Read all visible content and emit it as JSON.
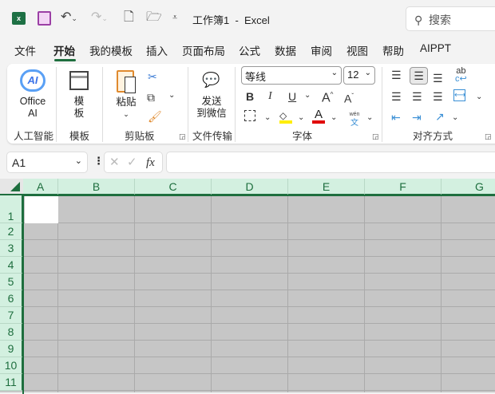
{
  "titlebar": {
    "app_icon": "excel-icon",
    "title": "工作簿1  -  Excel",
    "search_placeholder": "搜索"
  },
  "menu": {
    "tabs": [
      "文件",
      "开始",
      "我的模板",
      "插入",
      "页面布局",
      "公式",
      "数据",
      "审阅",
      "视图",
      "帮助",
      "AIPPT"
    ],
    "active": "开始"
  },
  "ribbon": {
    "office_ai": {
      "line1": "Office",
      "line2": "AI",
      "icon_text": "AI",
      "group": "人工智能"
    },
    "template": {
      "line1": "模",
      "line2": "板",
      "group": "模板"
    },
    "clipboard": {
      "paste": "粘贴",
      "group": "剪贴板"
    },
    "wechat": {
      "line1": "发送",
      "line2": "到微信",
      "group": "文件传输"
    },
    "font": {
      "name": "等线",
      "size": "12",
      "bold": "B",
      "italic": "I",
      "underline": "U",
      "grow": "A",
      "shrink": "A",
      "font_color": "A",
      "phonetic_top": "wén",
      "phonetic_bottom": "文",
      "group": "字体",
      "fill_color": "#ffee00",
      "text_color": "#e00000"
    },
    "alignment": {
      "wrap": "ab",
      "group": "对齐方式"
    }
  },
  "formula_bar": {
    "name_box": "A1",
    "fx": "fx",
    "formula": ""
  },
  "sheet": {
    "columns": [
      "A",
      "B",
      "C",
      "D",
      "E",
      "F",
      "G"
    ],
    "rows": [
      "1",
      "2",
      "3",
      "4",
      "5",
      "6",
      "7",
      "8",
      "9",
      "10",
      "11"
    ],
    "accent": "#1e6e3e"
  }
}
